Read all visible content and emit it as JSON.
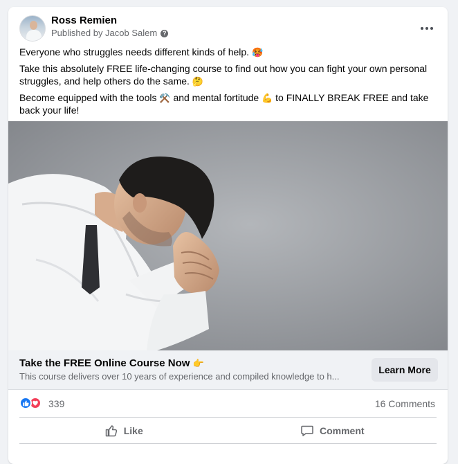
{
  "post": {
    "author": "Ross Remien",
    "published_by": "Published by Jacob Salem",
    "more_icon": "more-horizontal-icon",
    "paragraphs": {
      "p1": "Everyone who struggles needs different kinds of help.",
      "p1_emoji": "🥵",
      "p2": "Take this absolutely FREE life-changing course to find out how you can fight your own personal struggles, and help others do the same.",
      "p2_emoji": "🤔",
      "p3_a": "Become equipped with the tools",
      "p3_emoji1": "⚒️",
      "p3_b": "and mental fortitude",
      "p3_emoji2": "💪",
      "p3_c": "to FINALLY BREAK FREE and take back your life!"
    }
  },
  "ad": {
    "image_alt": "man in white shirt with head bowed, hands clasped",
    "title": "Take the FREE Online Course Now",
    "title_emoji": "👉",
    "description": "This course delivers over 10 years of experience and compiled knowledge to h...",
    "cta_label": "Learn More"
  },
  "stats": {
    "reaction_count": "339",
    "comments": "16 Comments"
  },
  "actions": {
    "like": "Like",
    "comment": "Comment"
  },
  "colors": {
    "like_blue": "#1877f2",
    "love_red": "#f33e58",
    "secondary_text": "#65676b"
  }
}
